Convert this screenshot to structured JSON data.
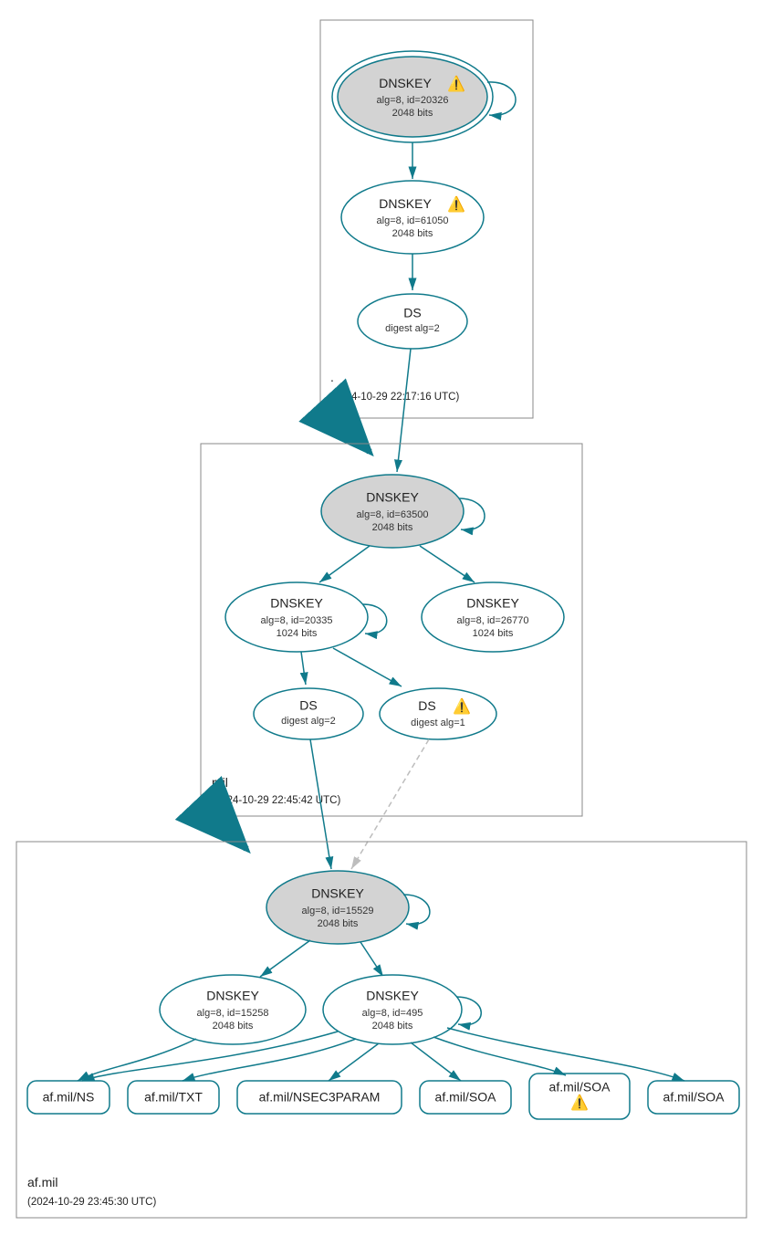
{
  "colors": {
    "teal": "#107a8b",
    "gray": "#bdbdbd",
    "sep": "#d3d3d3"
  },
  "zones": {
    "root": {
      "name": ".",
      "timestamp": "(2024-10-29 22:17:16 UTC)"
    },
    "mil": {
      "name": "mil",
      "timestamp": "(2024-10-29 22:45:42 UTC)"
    },
    "afmil": {
      "name": "af.mil",
      "timestamp": "(2024-10-29 23:45:30 UTC)"
    }
  },
  "nodes": {
    "root_ksk": {
      "title": "DNSKEY",
      "warn": true,
      "line2": "alg=8, id=20326",
      "line3": "2048 bits"
    },
    "root_zsk": {
      "title": "DNSKEY",
      "warn": true,
      "line2": "alg=8, id=61050",
      "line3": "2048 bits"
    },
    "root_ds": {
      "title": "DS",
      "warn": false,
      "line2": "digest alg=2",
      "line3": ""
    },
    "mil_ksk": {
      "title": "DNSKEY",
      "warn": false,
      "line2": "alg=8, id=63500",
      "line3": "2048 bits"
    },
    "mil_zsk1": {
      "title": "DNSKEY",
      "warn": false,
      "line2": "alg=8, id=20335",
      "line3": "1024 bits"
    },
    "mil_zsk2": {
      "title": "DNSKEY",
      "warn": false,
      "line2": "alg=8, id=26770",
      "line3": "1024 bits"
    },
    "mil_ds1": {
      "title": "DS",
      "warn": false,
      "line2": "digest alg=2",
      "line3": ""
    },
    "mil_ds2": {
      "title": "DS",
      "warn": true,
      "line2": "digest alg=1",
      "line3": ""
    },
    "af_ksk": {
      "title": "DNSKEY",
      "warn": false,
      "line2": "alg=8, id=15529",
      "line3": "2048 bits"
    },
    "af_zsk1": {
      "title": "DNSKEY",
      "warn": false,
      "line2": "alg=8, id=15258",
      "line3": "2048 bits"
    },
    "af_zsk2": {
      "title": "DNSKEY",
      "warn": false,
      "line2": "alg=8, id=495",
      "line3": "2048 bits"
    }
  },
  "rrsets": {
    "ns": {
      "label": "af.mil/NS",
      "warn": false
    },
    "txt": {
      "label": "af.mil/TXT",
      "warn": false
    },
    "nsec3": {
      "label": "af.mil/NSEC3PARAM",
      "warn": false
    },
    "soa1": {
      "label": "af.mil/SOA",
      "warn": false
    },
    "soa2": {
      "label": "af.mil/SOA",
      "warn": true
    },
    "soa3": {
      "label": "af.mil/SOA",
      "warn": false
    }
  }
}
